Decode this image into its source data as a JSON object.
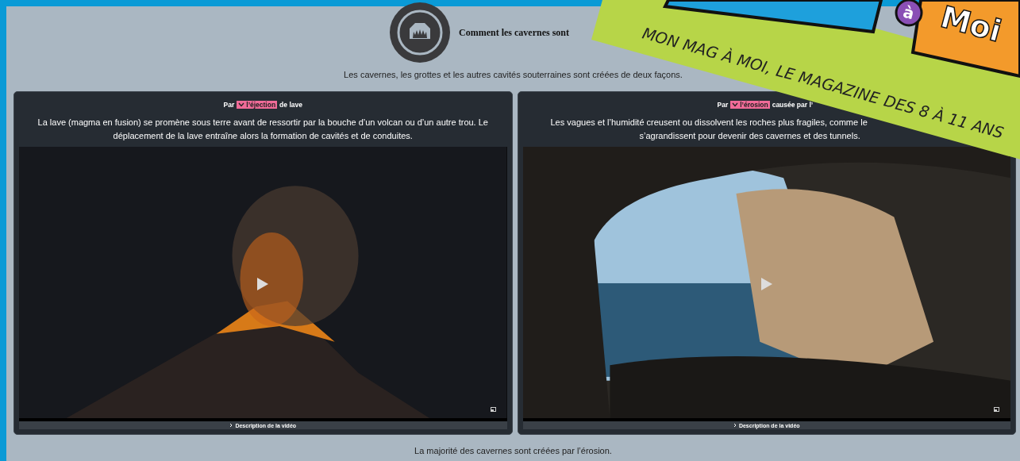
{
  "header": {
    "title": "Comment les cavernes sont"
  },
  "intro": "Les cavernes, les grottes et les autres cavités souterraines sont créées de deux façons.",
  "cards": [
    {
      "label": {
        "prefix": "Par",
        "term": "l’éjection",
        "suffix": "de lave",
        "expanded": false
      },
      "lines": [
        "La lave (magma en fusion) se promène sous terre avant de ressortir par la bouche d’un volcan ou d’un autre trou. Le",
        "déplacement de la lave entraîne alors la formation de cavités et de conduites."
      ],
      "video": {
        "kind": "volcano",
        "description": "Description de la vidéo"
      }
    },
    {
      "label": {
        "prefix": "Par",
        "term": "l’érosion",
        "suffix": "causée par l’",
        "expanded": false
      },
      "lines": [
        "Les vagues et l’humidité creusent ou dissolvent les roches plus fragiles, comme le",
        "s’agrandissent pour devenir des cavernes et des tunnels."
      ],
      "video": {
        "kind": "sea-cave",
        "description": "Description de la vidéo"
      }
    }
  ],
  "footer": "La majorité des cavernes sont créées par l’érosion.",
  "banner": {
    "tagline_parts": [
      "MON MAG À MOI,",
      "LE MAGAZINE",
      "DES 8 À 11 ANS"
    ],
    "logo_letter": "à",
    "logo_word": "Moi"
  }
}
